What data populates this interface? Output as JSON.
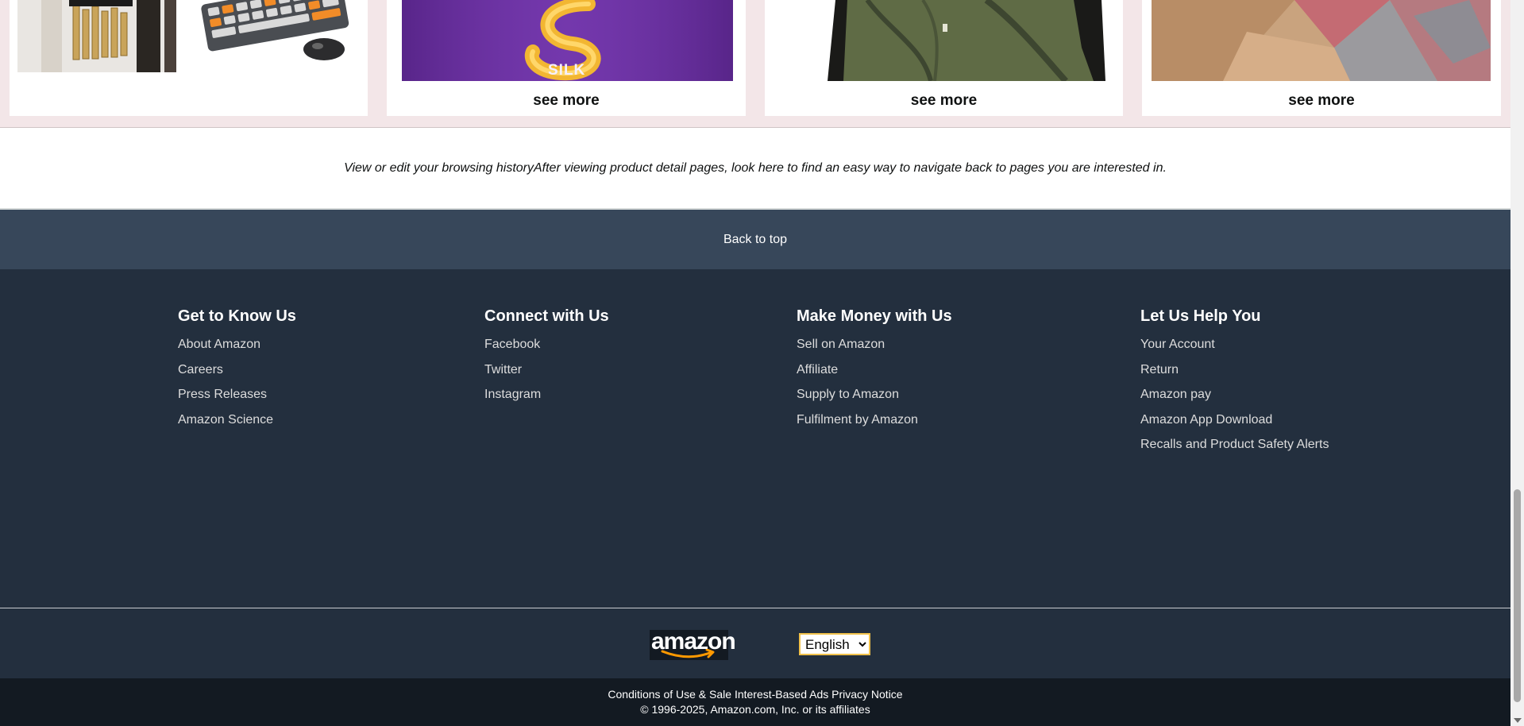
{
  "cards": [
    {
      "see_more": ""
    },
    {
      "see_more": "see more",
      "image_text": "SILK"
    },
    {
      "see_more": "see more"
    },
    {
      "see_more": "see more"
    }
  ],
  "history": {
    "text": "View or edit your browsing historyAfter viewing product detail pages, look here to find an easy way to navigate back to pages you are interested in."
  },
  "back_to_top": "Back to top",
  "footer_columns": [
    {
      "title": "Get to Know Us",
      "items": [
        "About Amazon",
        "Careers",
        "Press Releases",
        "Amazon Science"
      ]
    },
    {
      "title": "Connect with Us",
      "items": [
        "Facebook",
        "Twitter",
        "Instagram"
      ]
    },
    {
      "title": "Make Money with Us",
      "items": [
        "Sell on Amazon",
        "Affiliate",
        "Supply to Amazon",
        "Fulfilment by Amazon"
      ]
    },
    {
      "title": "Let Us Help You",
      "items": [
        "Your Account",
        "Return",
        "Amazon pay",
        "Amazon App Download",
        "Recalls and Product Safety Alerts"
      ]
    }
  ],
  "logo_text": "amazon",
  "language": {
    "selected": "English"
  },
  "bottom": {
    "links": [
      "Conditions of Use & Sale",
      "Interest-Based Ads",
      "Privacy Notice"
    ],
    "copyright": "© 1996-2025, Amazon.com, Inc. or its affiliates"
  },
  "colors": {
    "back_to_top_bg": "#37475a",
    "footer_bg": "#232f3e",
    "bottom_bg": "#131a22",
    "cards_strip_bg": "#f3e6e8"
  }
}
